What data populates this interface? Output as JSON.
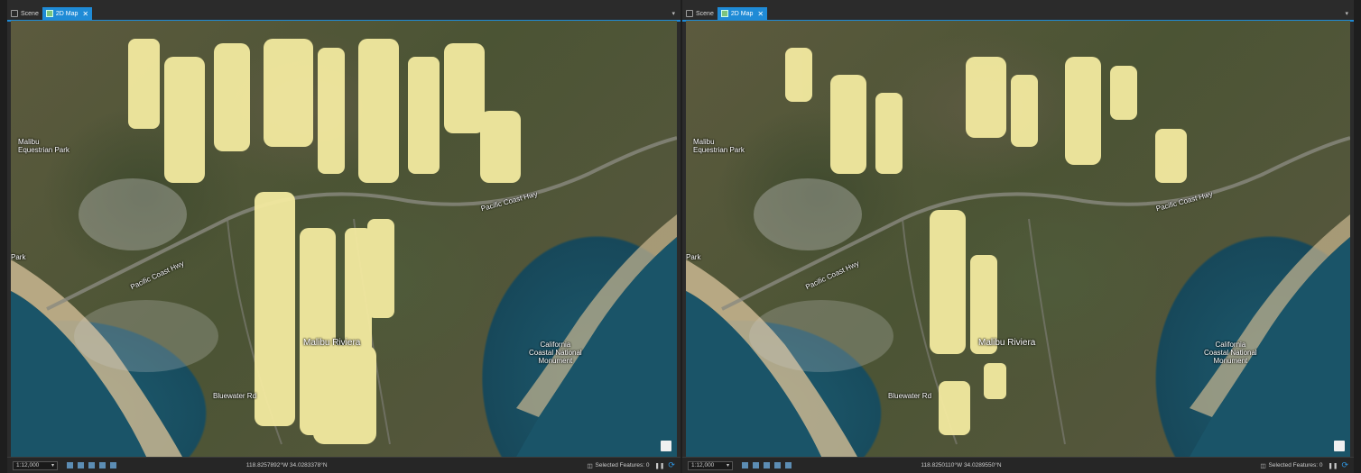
{
  "panes": [
    {
      "tabs": [
        {
          "label": "Scene",
          "active": false,
          "icon": "scene-icon"
        },
        {
          "label": "2D Map",
          "active": true,
          "icon": "map-icon"
        }
      ],
      "labels": {
        "malibu_park": "Malibu\nEquestrian Park",
        "pacific_coast_hwy": "Pacific Coast Hwy",
        "pacific_coast_hwy_2": "Pacific Coast Hwy",
        "malibu_riviera": "Malibu Riviera",
        "bluewater_rd": "Bluewater Rd",
        "ca_coastal": "California\nCoastal National\nMonument",
        "park_left": "Park"
      },
      "status": {
        "scale": "1:12,000",
        "coords": "118.8257892°W 34.0283378°N",
        "selected": "Selected Features: 0"
      }
    },
    {
      "tabs": [
        {
          "label": "Scene",
          "active": false,
          "icon": "scene-icon"
        },
        {
          "label": "2D Map",
          "active": true,
          "icon": "map-icon"
        }
      ],
      "labels": {
        "malibu_park": "Malibu\nEquestrian Park",
        "pacific_coast_hwy": "Pacific Coast Hwy",
        "pacific_coast_hwy_2": "Pacific Coast Hwy",
        "malibu_riviera": "Malibu Riviera",
        "bluewater_rd": "Bluewater Rd",
        "ca_coastal": "California\nCoastal National\nMonument",
        "park_left": "Park"
      },
      "status": {
        "scale": "1:12,000",
        "coords": "118.8250110°W 34.0289550°N",
        "selected": "Selected Features: 0"
      }
    }
  ],
  "colors": {
    "accent": "#1f8bd6",
    "building_footprint": "#f3eaa0",
    "water": "#1d5a6e"
  }
}
